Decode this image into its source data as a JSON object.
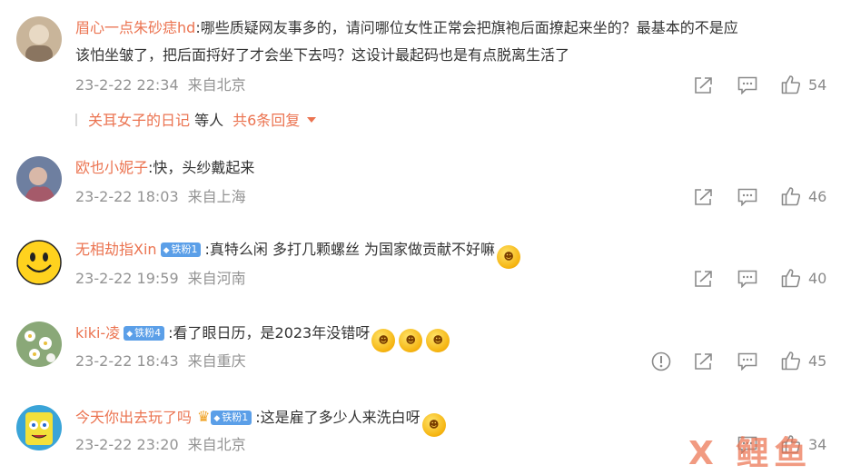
{
  "comments": [
    {
      "username": "眉心一点朱砂痣hd",
      "text_line1": ":哪些质疑网友事多的，请问哪位女性正常会把旗袍后面撩起来坐的？最基本的不是应",
      "text_line2": "该怕坐皱了，把后面捋好了才会坐下去吗？这设计最起码也是有点脱离生活了",
      "time": "23-2-22 22:34",
      "location": "来自北京",
      "likes": "54"
    },
    {
      "username": "欧也小妮子",
      "text": ":快，头纱戴起来",
      "time": "23-2-22 18:03",
      "location": "来自上海",
      "likes": "46"
    },
    {
      "username": "无相劫指Xin",
      "badge": "铁粉1",
      "text": ":真特么闲 多打几颗螺丝 为国家做贡献不好嘛",
      "time": "23-2-22 19:59",
      "location": "来自河南",
      "likes": "40"
    },
    {
      "username": "kiki-凌",
      "badge": "铁粉4",
      "text": ":看了眼日历，是2023年没错呀",
      "time": "23-2-22 18:43",
      "location": "来自重庆",
      "likes": "45"
    },
    {
      "username": "今天你出去玩了吗",
      "badge": "铁粉1",
      "text": ":这是雇了多少人来洗白呀",
      "time": "23-2-22 23:20",
      "location": "来自北京",
      "likes": "34"
    }
  ],
  "reply_summary": {
    "replier": "关耳女子的日记",
    "suffix": "等人",
    "more": "共6条回复"
  },
  "watermark": "X 鲤鱼",
  "icons": [
    "share-icon",
    "comment-icon",
    "like-icon",
    "report-icon",
    "caret-down-icon",
    "diamond-icon",
    "crown-icon"
  ],
  "colors": {
    "username": "#eb7350",
    "meta": "#939393",
    "badge": "#5b9fe8"
  }
}
